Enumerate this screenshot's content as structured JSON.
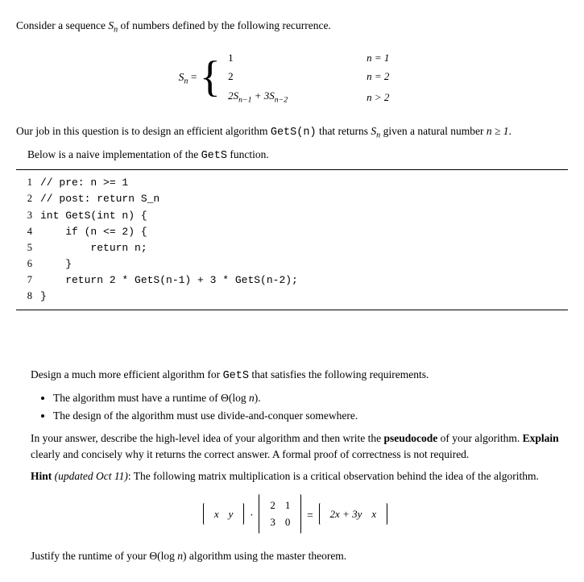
{
  "intro": {
    "p1_a": "Consider a sequence ",
    "p1_b": " of numbers defined by the following recurrence.",
    "seq": "S",
    "seq_sub": "n"
  },
  "recurrence": {
    "lhs_a": "S",
    "lhs_sub": "n",
    "eq": " = ",
    "r1_val": "1",
    "r1_cond": "n = 1",
    "r2_val": "2",
    "r2_cond": "n = 2",
    "r3_val_a": "2S",
    "r3_sub1": "n−1",
    "r3_plus": " + 3S",
    "r3_sub2": "n−2",
    "r3_cond": "n > 2"
  },
  "para2": {
    "a": "Our job in this question is to design an efficient algorithm ",
    "fn": "GetS(n)",
    "b": " that returns ",
    "c": " given a natural number ",
    "cond": "n ≥ 1",
    "d": "."
  },
  "para3": {
    "a": "Below is a naive implementation of the ",
    "fn": "GetS",
    "b": " function."
  },
  "code": {
    "l1": "// pre: n >= 1",
    "l2": "// post: return S_n",
    "l3": "int GetS(int n) {",
    "l4": "    if (n <= 2) {",
    "l5": "        return n;",
    "l6": "    }",
    "l7": "    return 2 * GetS(n-1) + 3 * GetS(n-2);",
    "l8": "}"
  },
  "question": {
    "p1_a": "Design a much more efficient algorithm for ",
    "p1_fn": "GetS",
    "p1_b": " that satisfies the following requirements.",
    "b1_a": "The algorithm must have a runtime of Θ(log ",
    "b1_n": "n",
    "b1_b": ").",
    "b2": "The design of the algorithm must use divide-and-conquer somewhere.",
    "p2_a": "In your answer, describe the high-level idea of your algorithm and then write the ",
    "p2_bold1": "pseudocode",
    "p2_b": " of your algorithm. ",
    "p2_bold2": "Explain",
    "p2_c": " clearly and concisely why it returns the correct answer. A formal proof of correctness is not required.",
    "hint_bold": "Hint",
    "hint_paren": " (updated Oct 11)",
    "hint_rest": ": The following matrix multiplication is a critical observation behind the idea of the algorithm.",
    "matrix": {
      "v_x": "x",
      "v_y": "y",
      "m00": "2",
      "m01": "1",
      "m10": "3",
      "m11": "0",
      "rhs_a": "2x + 3y",
      "rhs_b": "x"
    },
    "last_a": "Justify the runtime of your Θ(log ",
    "last_n": "n",
    "last_b": ") algorithm using the master theorem."
  }
}
